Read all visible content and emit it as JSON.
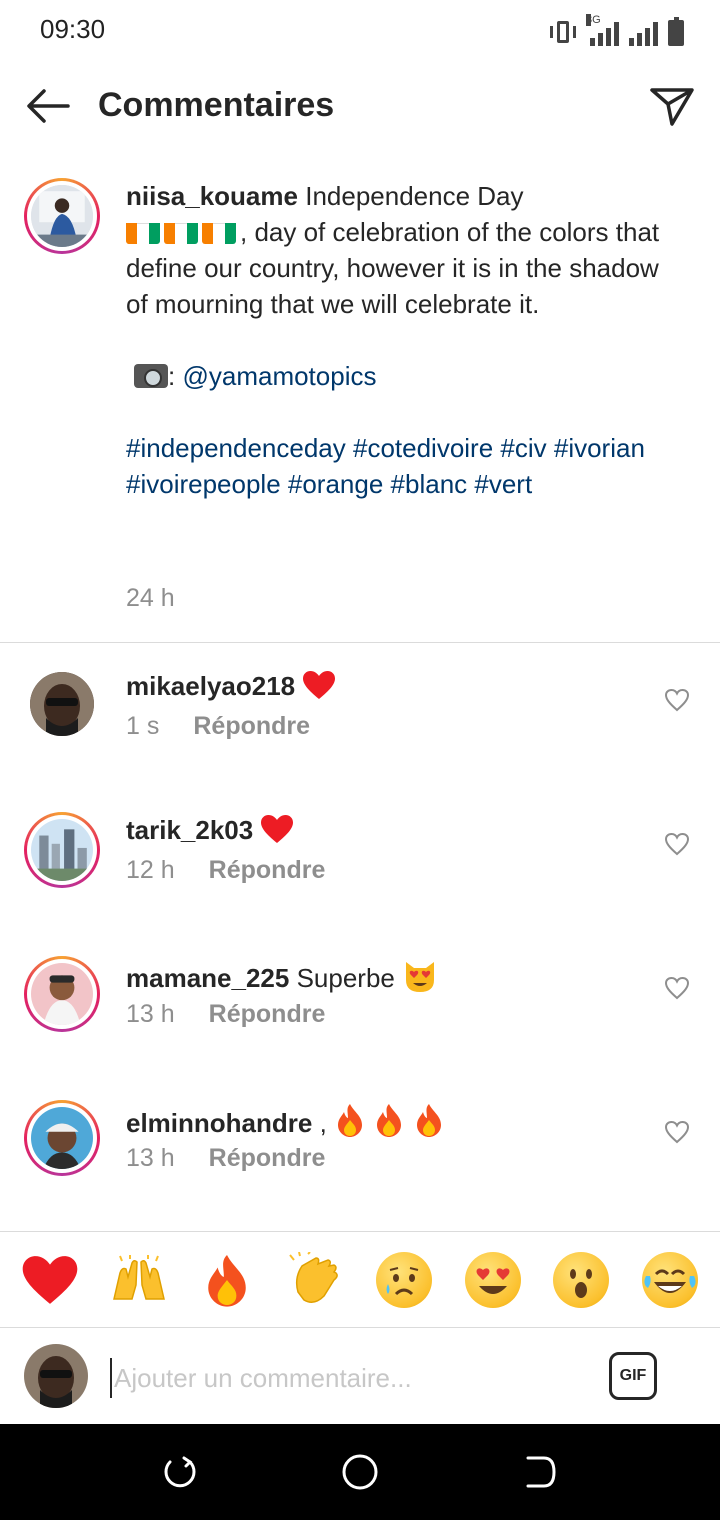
{
  "status_bar": {
    "time": "09:30",
    "network": "3G"
  },
  "header": {
    "title": "Commentaires",
    "back_icon": "arrow-left-icon",
    "share_icon": "paper-plane-icon"
  },
  "caption": {
    "username": "niisa_kouame",
    "text_start": "Independence Day",
    "text_after_flags": ", day of celebration of the colors that define our country, however it is in the shadow of mourning that we will celebrate it.",
    "camera_suffix": ":",
    "mention": "@yamamotopics",
    "hashtags": "#independenceday #cotedivoire #civ #ivorian #ivoirepeople #orange #blanc #vert",
    "time": "24 h"
  },
  "comments": [
    {
      "username": "mikaelyao218",
      "text": "",
      "emoji": "heart",
      "time": "1 s",
      "reply": "Répondre",
      "story_ring": false
    },
    {
      "username": "tarik_2k03",
      "text": "",
      "emoji": "heart",
      "time": "12 h",
      "reply": "Répondre",
      "story_ring": true
    },
    {
      "username": "mamane_225",
      "text": "Superbe",
      "emoji": "heart-eyes-cat",
      "time": "13 h",
      "reply": "Répondre",
      "story_ring": true
    },
    {
      "username": "elminnohandre",
      "text": ",",
      "emoji": "fire x3",
      "time": "13 h",
      "reply": "Répondre",
      "story_ring": true
    }
  ],
  "reactions": [
    "red-heart-emoji",
    "raising-hands-emoji",
    "fire-emoji",
    "clapping-hands-emoji",
    "sad-tear-emoji",
    "heart-eyes-emoji",
    "surprised-emoji",
    "tears-of-joy-emoji"
  ],
  "input": {
    "placeholder": "Ajouter un commentaire...",
    "gif_label": "GIF"
  },
  "colors": {
    "link": "#00376b",
    "secondary_text": "#8e8e8e",
    "heart": "#ed1c24"
  }
}
